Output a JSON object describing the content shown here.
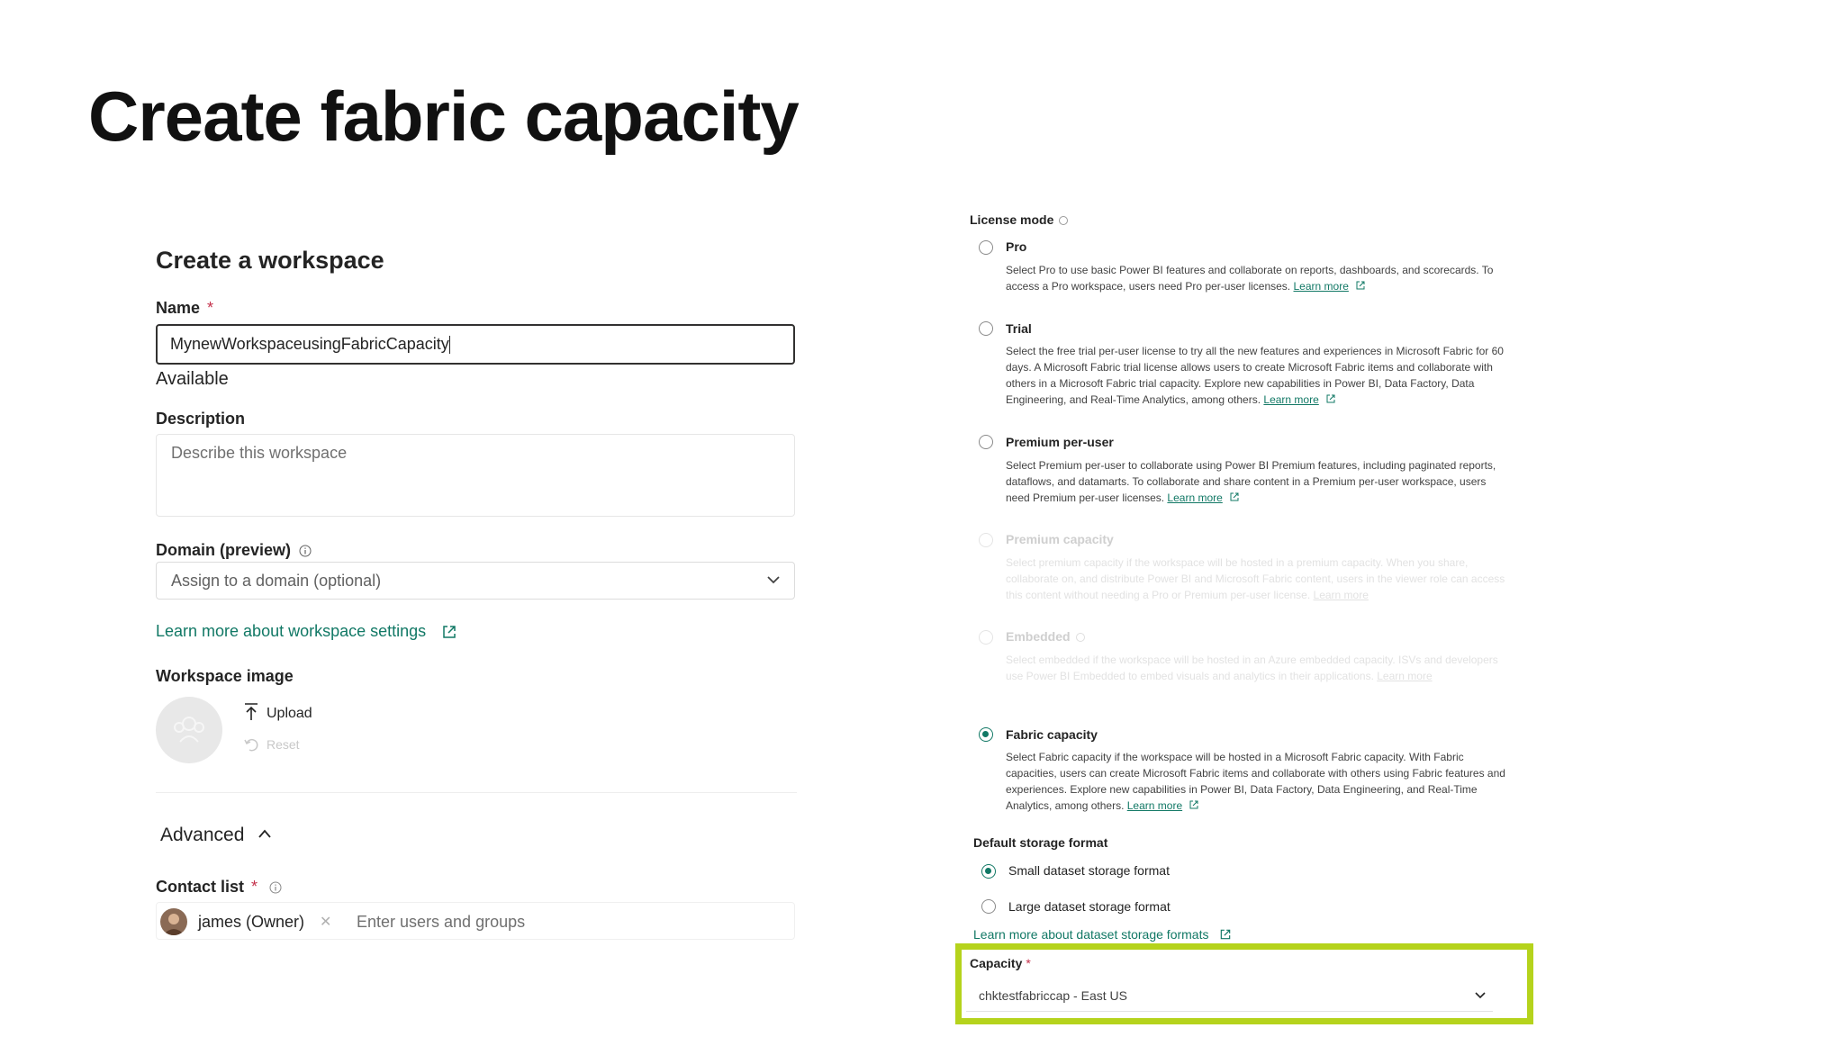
{
  "slide": {
    "title": "Create fabric capacity"
  },
  "workspace": {
    "heading": "Create a workspace",
    "name_label": "Name",
    "required_mark": "*",
    "name_value": "MynewWorkspaceusingFabricCapacity",
    "availability": "Available",
    "description_label": "Description",
    "description_placeholder": "Describe this workspace",
    "domain_label": "Domain (preview)",
    "domain_placeholder": "Assign to a domain (optional)",
    "settings_link": "Learn more about workspace settings",
    "image_label": "Workspace image",
    "upload_label": "Upload",
    "reset_label": "Reset",
    "advanced_label": "Advanced",
    "contact_label": "Contact list",
    "contact_chip": "james (Owner)",
    "contact_placeholder": "Enter users and groups"
  },
  "license": {
    "label": "License mode",
    "learn_more": "Learn more",
    "options": [
      {
        "title": "Pro",
        "selected": false,
        "disabled": false,
        "description": "Select Pro to use basic Power BI features and collaborate on reports, dashboards, and scorecards. To access a Pro workspace, users need Pro per-user licenses."
      },
      {
        "title": "Trial",
        "selected": false,
        "disabled": false,
        "description": "Select the free trial per-user license to try all the new features and experiences in Microsoft Fabric for 60 days. A Microsoft Fabric trial license allows users to create Microsoft Fabric items and collaborate with others in a Microsoft Fabric trial capacity. Explore new capabilities in Power BI, Data Factory, Data Engineering, and Real-Time Analytics, among others."
      },
      {
        "title": "Premium per-user",
        "selected": false,
        "disabled": false,
        "description": "Select Premium per-user to collaborate using Power BI Premium features, including paginated reports, dataflows, and datamarts. To collaborate and share content in a Premium per-user workspace, users need Premium per-user licenses."
      },
      {
        "title": "Premium capacity",
        "selected": false,
        "disabled": true,
        "description": "Select premium capacity if the workspace will be hosted in a premium capacity. When you share, collaborate on, and distribute Power BI and Microsoft Fabric content, users in the viewer role can access this content without needing a Pro or Premium per-user license."
      },
      {
        "title": "Embedded",
        "selected": false,
        "disabled": true,
        "description": "Select embedded if the workspace will be hosted in an Azure embedded capacity. ISVs and developers use Power BI Embedded to embed visuals and analytics in their applications."
      },
      {
        "title": "Fabric capacity",
        "selected": true,
        "disabled": false,
        "description": "Select Fabric capacity if the workspace will be hosted in a Microsoft Fabric capacity. With Fabric capacities, users can create Microsoft Fabric items and collaborate with others using Fabric features and experiences. Explore new capabilities in Power BI, Data Factory, Data Engineering, and Real-Time Analytics, among others."
      }
    ]
  },
  "storage": {
    "label": "Default storage format",
    "small": "Small dataset storage format",
    "large": "Large dataset storage format",
    "selected": "small",
    "link": "Learn more about dataset storage formats"
  },
  "capacity": {
    "label": "Capacity",
    "required_mark": "*",
    "value": "chktestfabriccap - East US",
    "highlight_color": "#b5d31c"
  },
  "colors": {
    "accent": "#117865",
    "required": "#c4314b"
  }
}
